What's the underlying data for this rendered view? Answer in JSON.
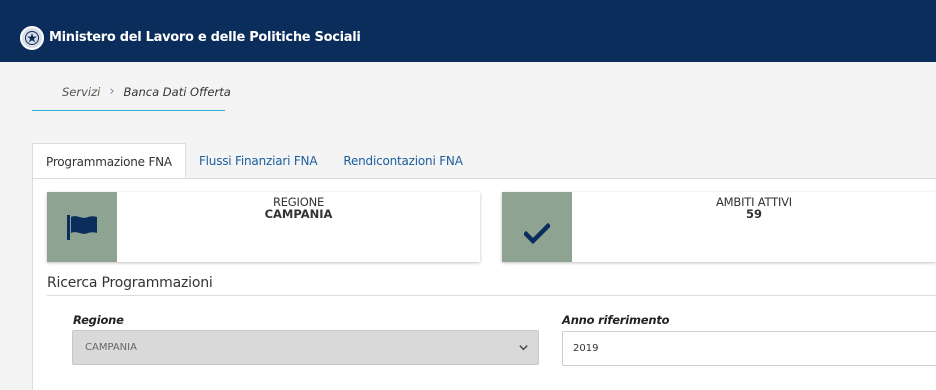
{
  "header": {
    "title": "Ministero del Lavoro e delle Politiche Sociali",
    "emblem_icon": "italian-republic-emblem-icon",
    "background_color": "#0b2d5b"
  },
  "breadcrumb": {
    "items": [
      {
        "label": "Servizi"
      },
      {
        "label": "Banca Dati Offerta"
      }
    ],
    "separator": ">"
  },
  "tabs": [
    {
      "label": "Programmazione FNA",
      "active": true
    },
    {
      "label": "Flussi Finanziari FNA",
      "active": false
    },
    {
      "label": "Rendicontazioni FNA",
      "active": false
    }
  ],
  "cards": {
    "regione": {
      "title": "REGIONE",
      "value": "CAMPANIA",
      "icon": "flag-icon"
    },
    "ambiti": {
      "title": "AMBITI ATTIVI",
      "value": "59",
      "icon": "checkmark-icon"
    },
    "icon_bg_color": "#8ea392"
  },
  "search": {
    "section_title": "Ricerca Programmazioni",
    "regione_label": "Regione",
    "regione_value": "CAMPANIA",
    "anno_label": "Anno riferimento",
    "anno_value": "2019"
  }
}
